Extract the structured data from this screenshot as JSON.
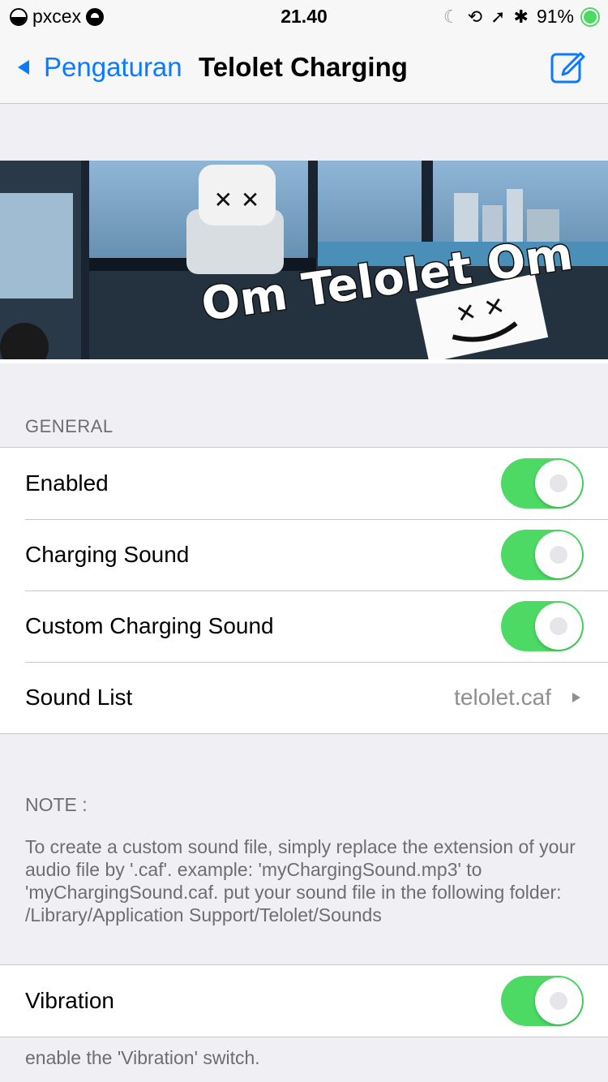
{
  "status_bar": {
    "carrier": "pxcex",
    "time": "21.40",
    "battery": "91%",
    "icons": [
      "signal-icon",
      "wifi-icon",
      "moon-icon",
      "rotation-lock-icon",
      "location-icon",
      "bluetooth-icon",
      "battery-icon"
    ]
  },
  "nav": {
    "back_label": "Pengaturan",
    "title": "Telolet Charging",
    "compose_icon": "compose-icon"
  },
  "banner": {
    "text": "Om Telolet Om"
  },
  "general": {
    "header": "GENERAL",
    "rows": [
      {
        "label": "Enabled",
        "on": true
      },
      {
        "label": "Charging Sound",
        "on": true
      },
      {
        "label": "Custom Charging Sound",
        "on": true
      }
    ],
    "sound_list": {
      "label": "Sound List",
      "value": "telolet.caf"
    }
  },
  "note": {
    "title": "NOTE :",
    "body": "To create a custom sound file, simply replace the extension of your audio file by '.caf'. example: 'myChargingSound.mp3' to 'myChargingSound.caf. put your sound file in the following folder: /Library/Application Support/Telolet/Sounds"
  },
  "vibration": {
    "label": "Vibration",
    "on": true,
    "footer": "enable the 'Vibration' switch."
  },
  "colors": {
    "accent": "#0a7aff",
    "switch_on": "#4cd964",
    "background": "#efeff4"
  }
}
